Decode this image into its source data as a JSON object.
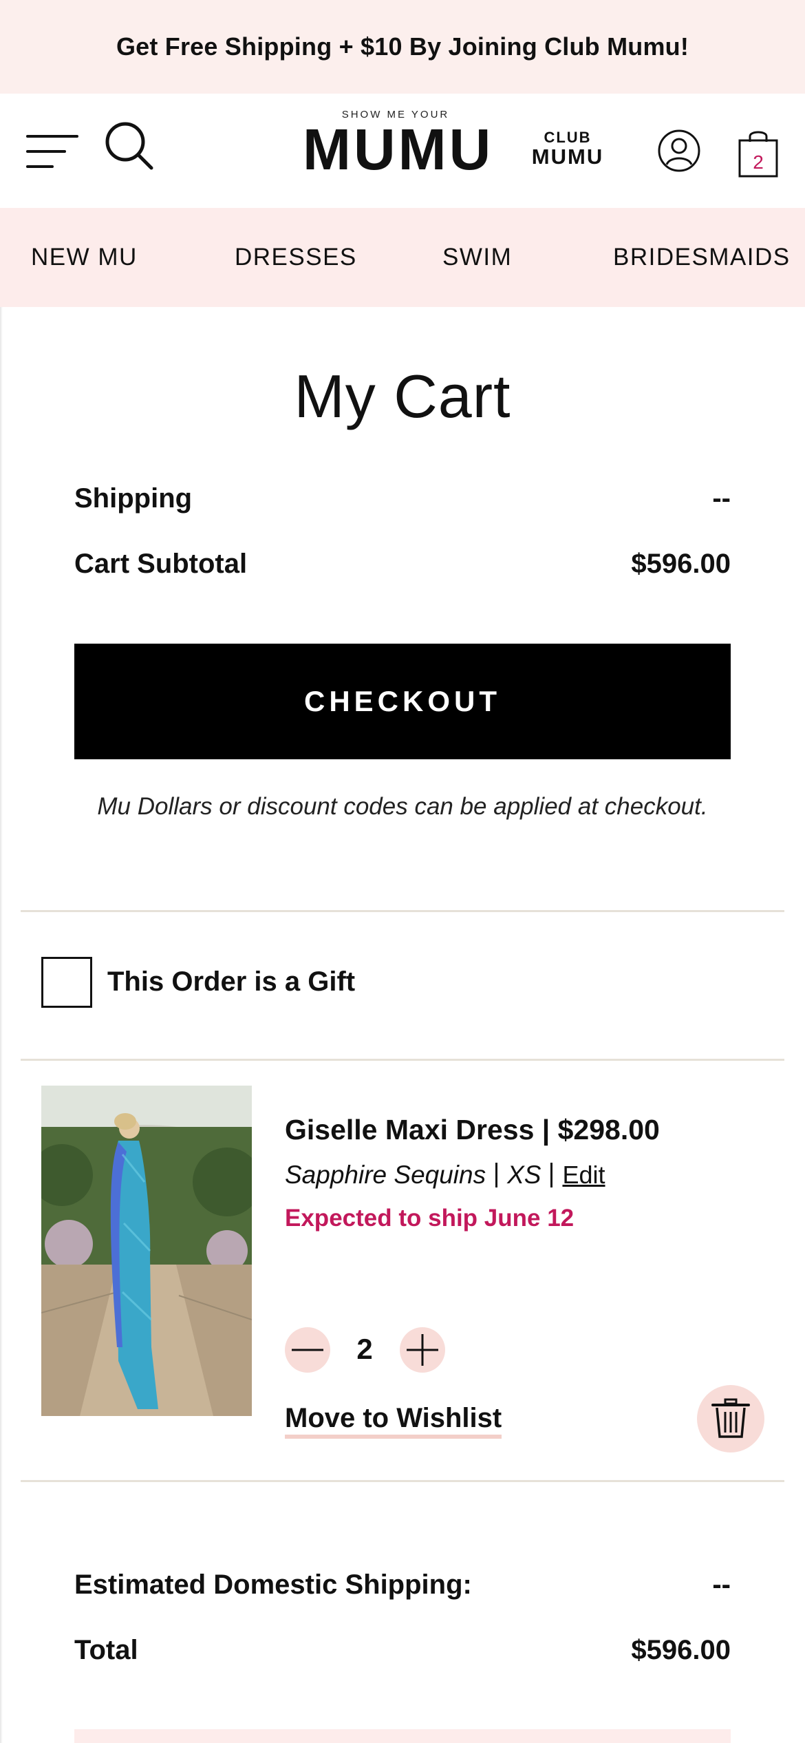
{
  "promo": {
    "text": "Get Free Shipping + $10 By Joining Club Mumu!"
  },
  "header": {
    "logo_small": "SHOW ME YOUR",
    "logo_big": "MUMU",
    "club_line1": "CLUB",
    "club_line2": "MUMU",
    "cart_count": "2",
    "icons": [
      "menu-icon",
      "search-icon",
      "account-icon",
      "shopping-bag-icon"
    ]
  },
  "nav": {
    "items": [
      "NEW MU",
      "DRESSES",
      "SWIM",
      "BRIDESMAIDS"
    ]
  },
  "cart": {
    "title": "My Cart",
    "shipping_label": "Shipping",
    "shipping_value": "--",
    "subtotal_label": "Cart Subtotal",
    "subtotal_value": "$596.00",
    "checkout_label": "CHECKOUT",
    "note": "Mu Dollars or discount codes can be applied at checkout.",
    "gift_label": "This Order is a Gift"
  },
  "item": {
    "name": "Giselle Maxi Dress | $298.00",
    "color": "Sapphire Sequins",
    "size": "XS",
    "edit": "Edit",
    "ship_note": "Expected to ship June 12",
    "quantity": "2",
    "wishlist": "Move to Wishlist"
  },
  "summary": {
    "est_shipping_label": "Estimated Domestic Shipping:",
    "est_shipping_value": "--",
    "total_label": "Total",
    "total_value": "$596.00"
  },
  "colors": {
    "promo_bg": "#fcefed",
    "nav_bg": "#fdeceb",
    "accent_pink": "#c2185b",
    "button_pink": "#f8dcd8",
    "checkout_bg": "#000000"
  }
}
